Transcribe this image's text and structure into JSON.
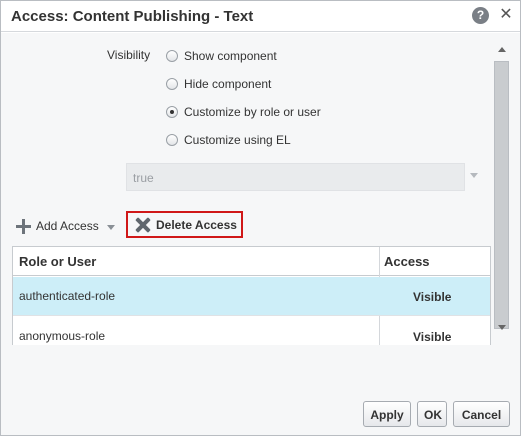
{
  "dialog": {
    "title": "Access: Content Publishing - Text",
    "help_icon": "?",
    "close_icon": "✕"
  },
  "visibility": {
    "label": "Visibility",
    "options": [
      {
        "label": "Show component",
        "checked": false
      },
      {
        "label": "Hide component",
        "checked": false
      },
      {
        "label": "Customize by role or user",
        "checked": true
      },
      {
        "label": "Customize using EL",
        "checked": false
      }
    ],
    "el_value": "true"
  },
  "toolbar": {
    "add_access_label": "Add Access",
    "delete_access_label": "Delete Access"
  },
  "table": {
    "headers": [
      "Role or User",
      "Access"
    ],
    "rows": [
      {
        "role": "authenticated-role",
        "access": "Visible",
        "selected": true
      },
      {
        "role": "anonymous-role",
        "access": "Visible",
        "selected": false
      }
    ]
  },
  "buttons": {
    "apply": "Apply",
    "ok": "OK",
    "cancel": "Cancel"
  },
  "colors": {
    "selected_row": "#cdeef8",
    "highlight_border": "#d01818"
  }
}
